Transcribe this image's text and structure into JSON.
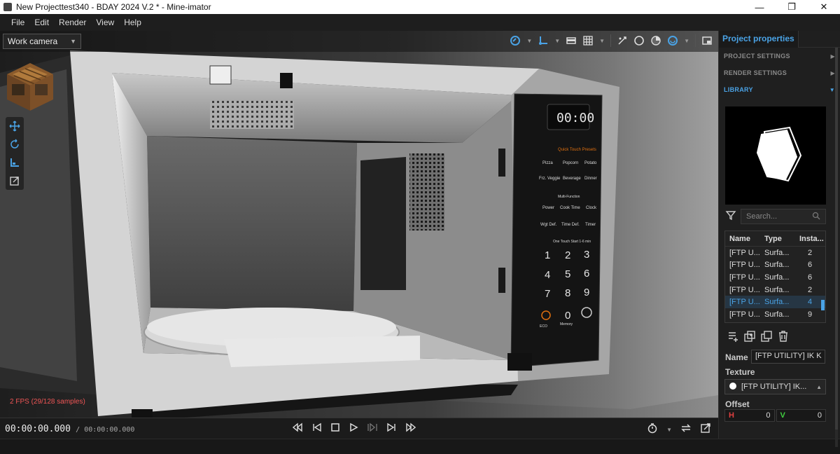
{
  "window": {
    "title": "New Projecttest340 - BDAY 2024 V.2 *  - Mine-imator",
    "minimize": "—",
    "maximize": "❐",
    "close": "✕"
  },
  "menu": [
    "File",
    "Edit",
    "Render",
    "View",
    "Help"
  ],
  "viewport": {
    "camera": "Work camera",
    "fps_text": "2 FPS (29/128 samples)"
  },
  "microwave": {
    "display": "00:00",
    "header": "Quick Touch Presets",
    "presets": [
      "Pizza",
      "Popcorn",
      "Potato",
      "Frz. Veggie",
      "Beverage",
      "Dinner"
    ],
    "multi_header": "Multi-Function",
    "multi": [
      "Power",
      "Cook Time",
      "Clock",
      "Wgt Def.",
      "Time Def.",
      "Timer"
    ],
    "touch_header": "One Touch Start 1-6 min",
    "keys": [
      "1",
      "2",
      "3",
      "4",
      "5",
      "6",
      "7",
      "8",
      "9",
      "0"
    ],
    "eco": "ECO",
    "memory": "Memory"
  },
  "timeline": {
    "current": "00:00:00.000",
    "total": "/ 00:00:00.000"
  },
  "panel": {
    "tab": "Project properties",
    "sections": [
      {
        "label": "PROJECT SETTINGS",
        "active": false
      },
      {
        "label": "RENDER SETTINGS",
        "active": false
      },
      {
        "label": "LIBRARY",
        "active": true
      }
    ],
    "search_placeholder": "Search...",
    "columns": [
      "Name",
      "Type",
      "Insta..."
    ],
    "rows": [
      {
        "name": "[FTP U...",
        "type": "Surfa...",
        "count": "2",
        "selected": false
      },
      {
        "name": "[FTP U...",
        "type": "Surfa...",
        "count": "6",
        "selected": false
      },
      {
        "name": "[FTP U...",
        "type": "Surfa...",
        "count": "6",
        "selected": false
      },
      {
        "name": "[FTP U...",
        "type": "Surfa...",
        "count": "2",
        "selected": false
      },
      {
        "name": "[FTP U...",
        "type": "Surfa...",
        "count": "4",
        "selected": true
      },
      {
        "name": "[FTP U...",
        "type": "Surfa...",
        "count": "9",
        "selected": false
      }
    ],
    "name_label": "Name",
    "name_value": "[FTP UTILITY] IK K",
    "texture_label": "Texture",
    "texture_value": "[FTP UTILITY] IK...",
    "offset_label": "Offset",
    "offset_h_label": "H",
    "offset_h": "0",
    "offset_v_label": "V",
    "offset_v": "0"
  },
  "colors": {
    "accent": "#4aa3e6",
    "fps": "#e55555",
    "offset_h": "#e04040",
    "offset_v": "#40d040"
  }
}
